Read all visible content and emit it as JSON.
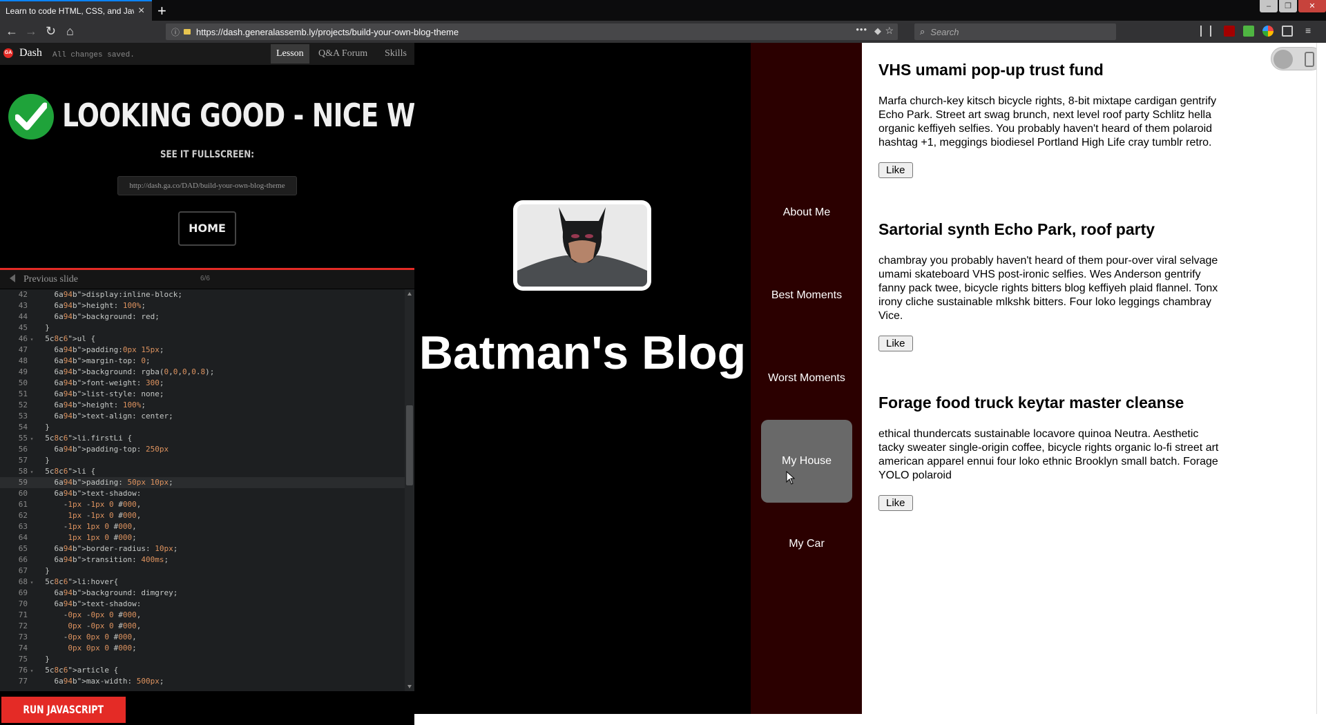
{
  "browser": {
    "tab_title": "Learn to code HTML, CSS, and Java",
    "url": "https://dash.generalassemb.ly/projects/build-your-own-blog-theme",
    "search_placeholder": "Search",
    "accent": "#0a84ff"
  },
  "dash": {
    "logo_text": "GA",
    "title": "Dash",
    "saved_status": "All changes saved.",
    "tabs": [
      {
        "label": "Lesson",
        "active": true
      },
      {
        "label": "Q&A Forum",
        "active": false
      },
      {
        "label": "Skills",
        "active": false
      }
    ],
    "success_heading": "LOOKING GOOD - NICE WORK!",
    "fullscreen_label": "SEE IT FULLSCREEN:",
    "share_link": "http://dash.ga.co/DAD/build-your-own-blog-theme",
    "home_label": "HOME",
    "previous_slide": "Previous slide",
    "slide_counter": "6/6",
    "run_button": "RUN JAVASCRIPT",
    "brand_red": "#e42b26"
  },
  "editor": {
    "lines": [
      {
        "n": "42",
        "text": "    display:inline-block;"
      },
      {
        "n": "43",
        "text": "    height: 100%;"
      },
      {
        "n": "44",
        "text": "    background: red;"
      },
      {
        "n": "45",
        "text": "  }"
      },
      {
        "n": "46",
        "text": "  ul {",
        "fold": true
      },
      {
        "n": "47",
        "text": "    padding:0px 15px;"
      },
      {
        "n": "48",
        "text": "    margin-top: 0;"
      },
      {
        "n": "49",
        "text": "    background: rgba(0,0,0,0.8);"
      },
      {
        "n": "50",
        "text": "    font-weight: 300;"
      },
      {
        "n": "51",
        "text": "    list-style: none;"
      },
      {
        "n": "52",
        "text": "    height: 100%;"
      },
      {
        "n": "53",
        "text": "    text-align: center;"
      },
      {
        "n": "54",
        "text": "  }"
      },
      {
        "n": "55",
        "text": "  li.firstLi {",
        "fold": true
      },
      {
        "n": "56",
        "text": "    padding-top: 250px"
      },
      {
        "n": "57",
        "text": "  }"
      },
      {
        "n": "58",
        "text": "  li {",
        "fold": true
      },
      {
        "n": "59",
        "text": "    padding: 50px 10px;",
        "highlight": true
      },
      {
        "n": "60",
        "text": "    text-shadow:"
      },
      {
        "n": "61",
        "text": "      -1px -1px 0 #000,"
      },
      {
        "n": "62",
        "text": "       1px -1px 0 #000,"
      },
      {
        "n": "63",
        "text": "      -1px 1px 0 #000,"
      },
      {
        "n": "64",
        "text": "       1px 1px 0 #000;"
      },
      {
        "n": "65",
        "text": "    border-radius: 10px;"
      },
      {
        "n": "66",
        "text": "    transition: 400ms;"
      },
      {
        "n": "67",
        "text": "  }"
      },
      {
        "n": "68",
        "text": "  li:hover{",
        "fold": true
      },
      {
        "n": "69",
        "text": "    background: dimgrey;"
      },
      {
        "n": "70",
        "text": "    text-shadow:"
      },
      {
        "n": "71",
        "text": "      -0px -0px 0 #000,"
      },
      {
        "n": "72",
        "text": "       0px -0px 0 #000,"
      },
      {
        "n": "73",
        "text": "      -0px 0px 0 #000,"
      },
      {
        "n": "74",
        "text": "       0px 0px 0 #000;"
      },
      {
        "n": "75",
        "text": "  }"
      },
      {
        "n": "76",
        "text": "  article {",
        "fold": true
      },
      {
        "n": "77",
        "text": "    max-width: 500px;"
      }
    ]
  },
  "preview": {
    "blog_title": "Batman's Blog",
    "nav_items": [
      "About Me",
      "Best Moments",
      "Worst Moments",
      "My House",
      "My Car"
    ],
    "hovered_item": "My House",
    "nav_bg": "#2b0000",
    "articles": [
      {
        "title": "VHS umami pop-up trust fund",
        "body": "Marfa church-key kitsch bicycle rights, 8-bit mixtape cardigan gentrify Echo Park. Street art swag brunch, next level roof party Schlitz hella organic keffiyeh selfies. You probably haven't heard of them polaroid hashtag +1, meggings biodiesel Portland High Life cray tumblr retro.",
        "like_label": "Like"
      },
      {
        "title": "Sartorial synth Echo Park, roof party",
        "body": "chambray you probably haven't heard of them pour-over viral selvage umami skateboard VHS post-ironic selfies. Wes Anderson gentrify fanny pack twee, bicycle rights bitters blog keffiyeh plaid flannel. Tonx irony cliche sustainable mlkshk bitters. Four loko leggings chambray Vice.",
        "like_label": "Like"
      },
      {
        "title": "Forage food truck keytar master cleanse",
        "body": "ethical thundercats sustainable locavore quinoa Neutra. Aesthetic tacky sweater single-origin coffee, bicycle rights organic lo-fi street art american apparel ennui four loko ethnic Brooklyn small batch. Forage YOLO polaroid",
        "like_label": "Like"
      }
    ]
  }
}
